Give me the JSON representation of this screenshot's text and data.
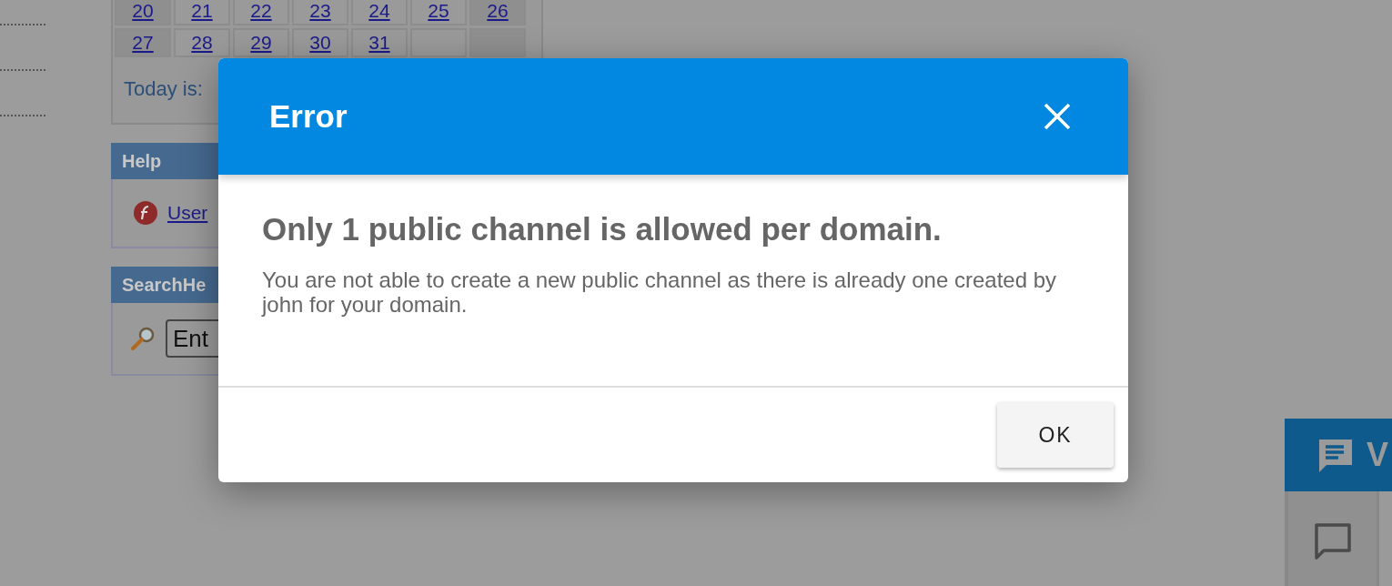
{
  "calendar": {
    "weeks": [
      [
        "20",
        "21",
        "22",
        "23",
        "24",
        "25",
        "26"
      ],
      [
        "27",
        "28",
        "29",
        "30",
        "31"
      ]
    ],
    "today_label": "Today is:"
  },
  "help": {
    "title": "Help",
    "items": [
      {
        "label": "User"
      }
    ]
  },
  "search": {
    "title": "SearchHe",
    "value": "Ent"
  },
  "chat_widget": {
    "title": "V"
  },
  "dialog": {
    "title": "Error",
    "heading": "Only 1 public channel is allowed per domain.",
    "message": "You are not able to create a new public channel as there is already one created by john for your domain.",
    "button": "OK"
  }
}
